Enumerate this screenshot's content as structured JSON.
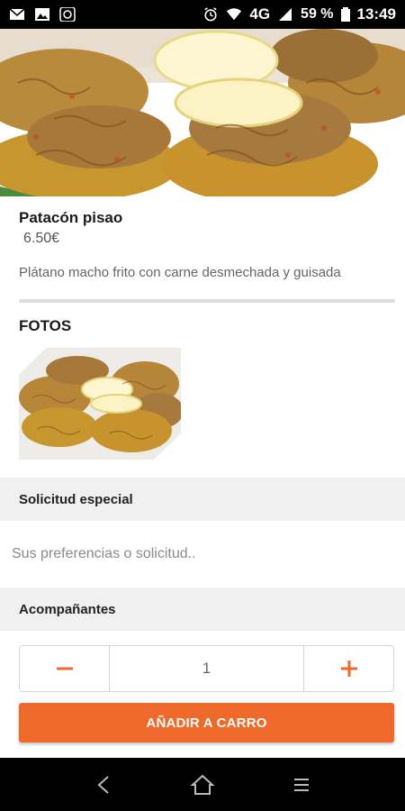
{
  "status_bar": {
    "network": "4G",
    "battery": "59 %",
    "time": "13:49"
  },
  "product": {
    "name": "Patacón pisao",
    "price": "6.50€",
    "description": "Plátano macho frito con carne desmechada y guisada"
  },
  "photos": {
    "title": "FOTOS"
  },
  "special_request": {
    "title": "Solicitud especial",
    "placeholder": "Sus preferencias o solicitud.."
  },
  "sides": {
    "title": "Acompañantes"
  },
  "stepper": {
    "quantity": "1"
  },
  "cart": {
    "add_label": "AÑADIR A CARRO"
  },
  "colors": {
    "accent": "#ef6a2a",
    "section_bg": "#f0f0f0"
  },
  "icons": {
    "status_left": [
      "mail-icon",
      "image-icon",
      "app-icon"
    ],
    "status_right": [
      "alarm-icon",
      "wifi-icon",
      "signal-icon"
    ],
    "nav": [
      "back-icon",
      "home-icon",
      "menu-icon"
    ]
  }
}
